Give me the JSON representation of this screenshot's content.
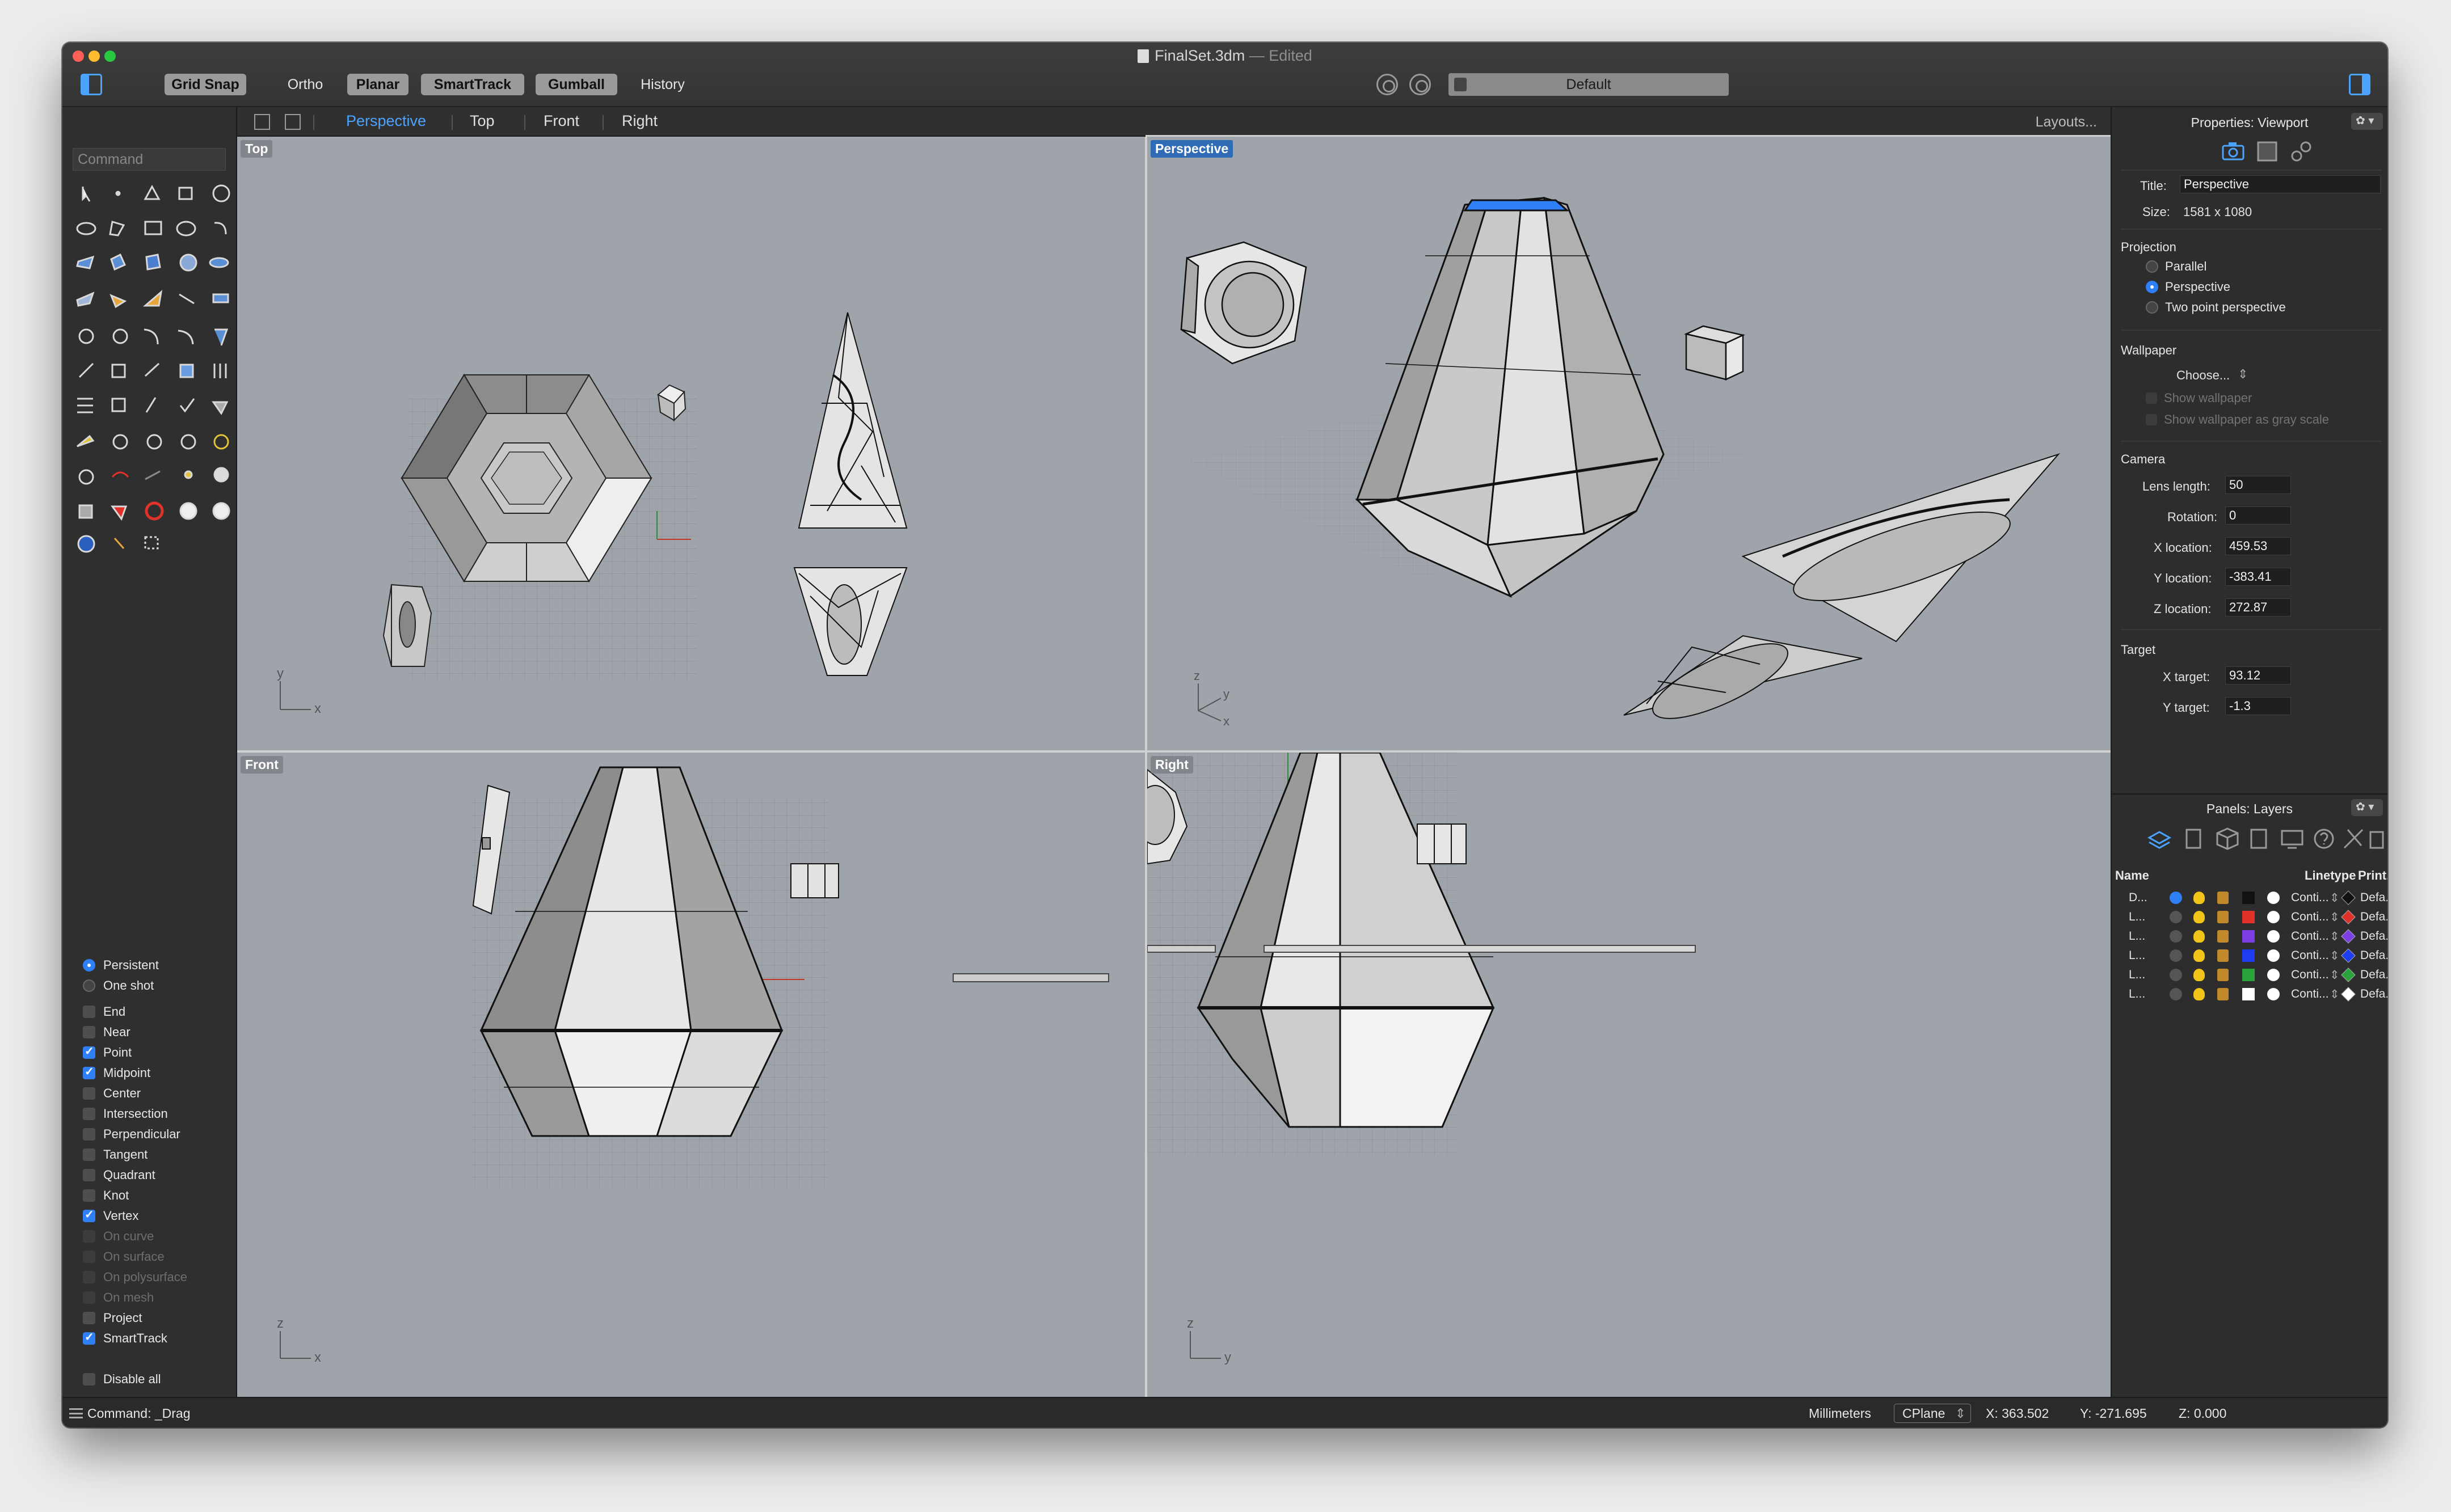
{
  "window": {
    "title": "FinalSet.3dm",
    "title_suffix": "— Edited"
  },
  "toolbar": {
    "modes": [
      {
        "label": "Grid Snap",
        "on": true
      },
      {
        "label": "Ortho",
        "on": false
      },
      {
        "label": "Planar",
        "on": true
      },
      {
        "label": "SmartTrack",
        "on": true
      },
      {
        "label": "Gumball",
        "on": true
      },
      {
        "label": "History",
        "on": false
      }
    ],
    "display_mode": "Default"
  },
  "viewport_tabs": {
    "tabs": [
      "Perspective",
      "Top",
      "Front",
      "Right"
    ],
    "active": "Perspective",
    "layouts_label": "Layouts..."
  },
  "viewports": {
    "top_label": "Top",
    "perspective_label": "Perspective",
    "front_label": "Front",
    "right_label": "Right",
    "axes": {
      "x": "x",
      "y": "y",
      "z": "z"
    }
  },
  "command": {
    "placeholder": "Command",
    "status": "Command: _Drag"
  },
  "osnap": {
    "modes": [
      {
        "label": "Persistent",
        "on": true
      },
      {
        "label": "One shot",
        "on": false
      }
    ],
    "items": [
      {
        "label": "End",
        "on": false,
        "enabled": true
      },
      {
        "label": "Near",
        "on": false,
        "enabled": true
      },
      {
        "label": "Point",
        "on": true,
        "enabled": true
      },
      {
        "label": "Midpoint",
        "on": true,
        "enabled": true
      },
      {
        "label": "Center",
        "on": false,
        "enabled": true
      },
      {
        "label": "Intersection",
        "on": false,
        "enabled": true
      },
      {
        "label": "Perpendicular",
        "on": false,
        "enabled": true
      },
      {
        "label": "Tangent",
        "on": false,
        "enabled": true
      },
      {
        "label": "Quadrant",
        "on": false,
        "enabled": true
      },
      {
        "label": "Knot",
        "on": false,
        "enabled": true
      },
      {
        "label": "Vertex",
        "on": true,
        "enabled": true
      },
      {
        "label": "On curve",
        "on": false,
        "enabled": false
      },
      {
        "label": "On surface",
        "on": false,
        "enabled": false
      },
      {
        "label": "On polysurface",
        "on": false,
        "enabled": false
      },
      {
        "label": "On mesh",
        "on": false,
        "enabled": false
      },
      {
        "label": "Project",
        "on": false,
        "enabled": true
      },
      {
        "label": "SmartTrack",
        "on": true,
        "enabled": true
      }
    ],
    "disable_all": "Disable all"
  },
  "properties": {
    "panel_title": "Properties: Viewport",
    "title_label": "Title:",
    "title_value": "Perspective",
    "size_label": "Size:",
    "size_value": "1581 x 1080",
    "projection_label": "Projection",
    "projection_options": [
      {
        "label": "Parallel",
        "on": false
      },
      {
        "label": "Perspective",
        "on": true
      },
      {
        "label": "Two point perspective",
        "on": false
      }
    ],
    "wallpaper_label": "Wallpaper",
    "wallpaper_choose": "Choose...",
    "show_wallpaper": "Show wallpaper",
    "show_gray": "Show wallpaper as gray scale",
    "camera_label": "Camera",
    "lens_label": "Lens length:",
    "lens_value": "50",
    "rotation_label": "Rotation:",
    "rotation_value": "0",
    "xloc_label": "X location:",
    "xloc_value": "459.53",
    "yloc_label": "Y location:",
    "yloc_value": "-383.41",
    "zloc_label": "Z location:",
    "zloc_value": "272.87",
    "target_label": "Target",
    "xtarget_label": "X target:",
    "xtarget_value": "93.12",
    "ytarget_label": "Y target:",
    "ytarget_value": "-1.3"
  },
  "layers": {
    "panel_title": "Panels: Layers",
    "col_name": "Name",
    "col_linetype": "Linetype",
    "col_print": "Print...",
    "rows": [
      {
        "name": "D...",
        "current": true,
        "color": "#111111",
        "linetype": "Conti...",
        "print": "Defa...",
        "print_color": "#111111"
      },
      {
        "name": "L...",
        "current": false,
        "color": "#e0312b",
        "linetype": "Conti...",
        "print": "Defa...",
        "print_color": "#e0312b"
      },
      {
        "name": "L...",
        "current": false,
        "color": "#7b3fe4",
        "linetype": "Conti...",
        "print": "Defa...",
        "print_color": "#7b3fe4"
      },
      {
        "name": "L...",
        "current": false,
        "color": "#1f3df0",
        "linetype": "Conti...",
        "print": "Defa...",
        "print_color": "#1f3df0"
      },
      {
        "name": "L...",
        "current": false,
        "color": "#2aa33a",
        "linetype": "Conti...",
        "print": "Defa...",
        "print_color": "#2aa33a"
      },
      {
        "name": "L...",
        "current": false,
        "color": "#ffffff",
        "linetype": "Conti...",
        "print": "Defa...",
        "print_color": "#ffffff"
      }
    ],
    "add_label": "+ —",
    "gear_label": "✿ ▾"
  },
  "status": {
    "units": "Millimeters",
    "cplane": "CPlane",
    "x": "X: 363.502",
    "y": "Y: -271.695",
    "z": "Z: 0.000"
  },
  "colors": {
    "accent": "#4aa3ff",
    "viewport_bg": "#9fa4ab",
    "active_label": "#2f6cb5"
  }
}
